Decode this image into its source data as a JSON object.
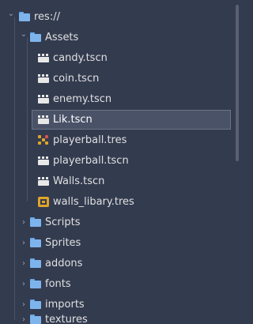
{
  "tree": {
    "root": {
      "label": "res://",
      "icon": "folder-icon",
      "expanded": true
    },
    "assets": {
      "label": "Assets",
      "icon": "folder-icon",
      "expanded": true
    },
    "assets_items": [
      {
        "label": "candy.tscn",
        "icon": "scene-icon"
      },
      {
        "label": "coin.tscn",
        "icon": "scene-icon"
      },
      {
        "label": "enemy.tscn",
        "icon": "scene-icon"
      },
      {
        "label": "Lik.tscn",
        "icon": "scene-icon",
        "selected": true
      },
      {
        "label": "playerball.tres",
        "icon": "resource-icon"
      },
      {
        "label": "playerball.tscn",
        "icon": "scene-icon"
      },
      {
        "label": "Walls.tscn",
        "icon": "scene-icon"
      },
      {
        "label": "walls_libary.tres",
        "icon": "tileset-icon"
      }
    ],
    "folders": [
      {
        "label": "Scripts",
        "icon": "folder-icon",
        "expanded": false
      },
      {
        "label": "Sprites",
        "icon": "folder-icon",
        "expanded": false
      },
      {
        "label": "addons",
        "icon": "folder-icon",
        "expanded": false
      },
      {
        "label": "fonts",
        "icon": "folder-icon",
        "expanded": false
      },
      {
        "label": "imports",
        "icon": "folder-icon",
        "expanded": false
      },
      {
        "label": "textures",
        "icon": "folder-icon",
        "expanded": false
      }
    ]
  },
  "colors": {
    "background": "#333b4f",
    "folder": "#7eb4ec",
    "selection": "#4a5268",
    "text": "#e0e0e0"
  },
  "arrows": {
    "expanded": "⌄",
    "collapsed": "›"
  }
}
